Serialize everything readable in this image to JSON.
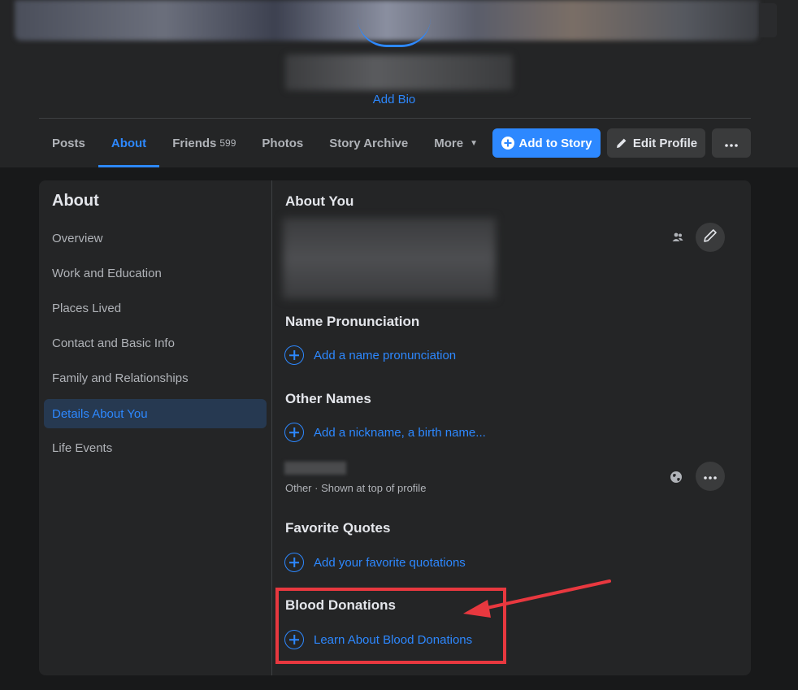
{
  "header": {
    "add_bio": "Add Bio"
  },
  "tabs": [
    {
      "label": "Posts"
    },
    {
      "label": "About"
    },
    {
      "label": "Friends",
      "count": "599"
    },
    {
      "label": "Photos"
    },
    {
      "label": "Story Archive"
    },
    {
      "label": "More"
    }
  ],
  "actions": {
    "add_story": "Add to Story",
    "edit_profile": "Edit Profile"
  },
  "sidebar": {
    "title": "About",
    "items": [
      {
        "label": "Overview"
      },
      {
        "label": "Work and Education"
      },
      {
        "label": "Places Lived"
      },
      {
        "label": "Contact and Basic Info"
      },
      {
        "label": "Family and Relationships"
      },
      {
        "label": "Details About You",
        "active": true
      },
      {
        "label": "Life Events"
      }
    ]
  },
  "content": {
    "about_you": "About You",
    "name_pronunciation": {
      "title": "Name Pronunciation",
      "action": "Add a name pronunciation"
    },
    "other_names": {
      "title": "Other Names",
      "action": "Add a nickname, a birth name...",
      "entry_sub": "Other · Shown at top of profile"
    },
    "favorite_quotes": {
      "title": "Favorite Quotes",
      "action": "Add your favorite quotations"
    },
    "blood_donations": {
      "title": "Blood Donations",
      "action": "Learn About Blood Donations"
    }
  },
  "colors": {
    "accent": "#2d88ff",
    "annotation": "#e8383f"
  }
}
